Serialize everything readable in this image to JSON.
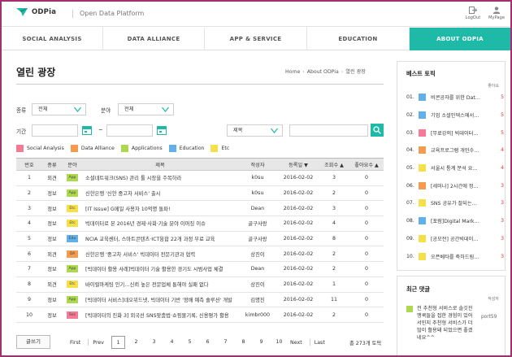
{
  "header": {
    "logo": "ODPia",
    "platform": "Open Data Platform",
    "logout": "LogOut",
    "mypage": "MyPage"
  },
  "nav": [
    {
      "label": "SOCIAL ANALYSIS",
      "active": false
    },
    {
      "label": "DATA ALLIANCE",
      "active": false
    },
    {
      "label": "APP & SERVICE",
      "active": false
    },
    {
      "label": "EDUCATION",
      "active": false
    },
    {
      "label": "ABOUT ODPIA",
      "active": true
    }
  ],
  "page": {
    "title": "열린 광장",
    "breadcrumb": [
      "Home",
      "About ODPia",
      "열린 광장"
    ]
  },
  "filters": {
    "type_label": "종류",
    "type_value": "전체",
    "category_label": "분야",
    "category_value": "전체",
    "period_label": "기간",
    "period_sep": "~",
    "search_field": "제목"
  },
  "legend": [
    {
      "label": "Social Analysis",
      "color": "#f47a96"
    },
    {
      "label": "Data Alliance",
      "color": "#f59b4f"
    },
    {
      "label": "Applications",
      "color": "#aed94f"
    },
    {
      "label": "Education",
      "color": "#62b0e8"
    },
    {
      "label": "Etc",
      "color": "#f5e04a"
    }
  ],
  "table": {
    "headers": [
      "번호",
      "종류",
      "분야",
      "제목",
      "작성자",
      "등록일 ▼",
      "조회수 ▲",
      "좋아요수 ▲"
    ],
    "rows": [
      {
        "no": "1",
        "type": "외견",
        "tag": "App",
        "tag_color": "#aed94f",
        "title": "소셜네트워크(SNS) 관리 툴 시장을 주목하라",
        "author": "k0su",
        "date": "2016-02-02",
        "views": "3",
        "likes": "0"
      },
      {
        "no": "2",
        "type": "정보",
        "tag": "App",
        "tag_color": "#aed94f",
        "title": "신한은행 '신한 중고차 서비스' 출시",
        "author": "k0su",
        "date": "2016-02-02",
        "views": "2",
        "likes": "0"
      },
      {
        "no": "3",
        "type": "정보",
        "tag": "Etc",
        "tag_color": "#f5e04a",
        "title": "[IT Issue] G메일 사용자 10억명 돌파!",
        "author": "Dean",
        "date": "2016-02-02",
        "views": "3",
        "likes": "0"
      },
      {
        "no": "4",
        "type": "정보",
        "tag": "Etc",
        "tag_color": "#f5e04a",
        "title": "빅데이터로 본 2016년 경제·사회·기술 분야 이머징 이슈",
        "author": "골구사랑",
        "date": "2016-02-02",
        "views": "4",
        "likes": "0"
      },
      {
        "no": "5",
        "type": "정보",
        "tag": "Edu",
        "tag_color": "#62b0e8",
        "title": "NCIA 교육센터, 스마트콘텐츠·ICT융합 22개 과정 무료 교육",
        "author": "골구사랑",
        "date": "2016-02-02",
        "views": "8",
        "likes": "0"
      },
      {
        "no": "6",
        "type": "외견",
        "tag": "DA",
        "tag_color": "#f59b4f",
        "title": "신한은행 '중고차 서비스' 빅데이터 전문기관과 협력",
        "author": "상진이",
        "date": "2016-02-02",
        "views": "2",
        "likes": "0"
      },
      {
        "no": "7",
        "type": "정보",
        "tag": "App",
        "tag_color": "#aed94f",
        "title": "[빅데이터 활용 사례]빅데이터 기술 활용한 경기도 시범사업 체결",
        "author": "Dean",
        "date": "2016-02-02",
        "views": "2",
        "likes": "0"
      },
      {
        "no": "8",
        "type": "외견",
        "tag": "Etc",
        "tag_color": "#f5e04a",
        "title": "바이럴마케팅 인기…신뢰 높은 전문업체 통해야 실패 없다",
        "author": "상진이",
        "date": "2016-02-02",
        "views": "1",
        "likes": "0"
      },
      {
        "no": "9",
        "type": "정보",
        "tag": "App",
        "tag_color": "#aed94f",
        "title": "[빅데이터 서비스]네오위드넷, 빅데이터 기반 '정배 예측 솔루션' 개발",
        "author": "김명진",
        "date": "2016-02-02",
        "views": "11",
        "likes": "0"
      },
      {
        "no": "10",
        "type": "정보",
        "tag": "Soc",
        "tag_color": "#f47a96",
        "title": "[빅데이터의 진화 3] 외국선 SNS맞춤법·쇼핑몰기록, 신용평가 활용",
        "author": "kimbr000",
        "date": "2016-02-02",
        "views": "2",
        "likes": "0"
      }
    ]
  },
  "bottom": {
    "write_button": "글쓰기",
    "first": "First",
    "prev": "Prev",
    "pages": [
      "1",
      "2",
      "3",
      "4",
      "5",
      "6",
      "7",
      "8",
      "9",
      "10"
    ],
    "current_page": "1",
    "next": "Next",
    "last": "Last",
    "total": "총 273개 토픽"
  },
  "best_topics": {
    "title": "베스트 토픽",
    "count_header": "좋아요",
    "items": [
      {
        "no": "01.",
        "color": "#62b0e8",
        "text": "비콘공자를 위한 Dat…",
        "count": "5"
      },
      {
        "no": "02.",
        "color": "#62b0e8",
        "text": "기업 소셜인덱스에서…",
        "count": "5"
      },
      {
        "no": "03.",
        "color": "#f47a96",
        "text": "[무료강의] 빅데이터…",
        "count": "5"
      },
      {
        "no": "04.",
        "color": "#f59b4f",
        "text": "교육프로그램 개인수…",
        "count": "4"
      },
      {
        "no": "05.",
        "color": "#f5e04a",
        "text": "서울시 통계 분석 요…",
        "count": "4"
      },
      {
        "no": "06.",
        "color": "#f59b4f",
        "text": "[세미나] 2시간에 정…",
        "count": "3"
      },
      {
        "no": "07.",
        "color": "#f5e04a",
        "text": "SNS 공유가 잘되는…",
        "count": "3"
      },
      {
        "no": "08.",
        "color": "#62b0e8",
        "text": "[포럼]Digital Mark…",
        "count": "3"
      },
      {
        "no": "09.",
        "color": "#f5e04a",
        "text": "[공모전] 공간빅데이…",
        "count": "3"
      },
      {
        "no": "10.",
        "color": "#f5e04a",
        "text": "오픈베타를 축하드림…",
        "count": "3"
      }
    ]
  },
  "recent_comments": {
    "title": "최근 댓글",
    "author_header": "작성자",
    "item_text": "전 추천형 서비스로 솔깃진 맹쿡들을 접한 경험이 있어 서민지 추천형 서비스가 더 많이 활용돼 되었으면 좋겠네요^^",
    "item_author": "port59"
  }
}
